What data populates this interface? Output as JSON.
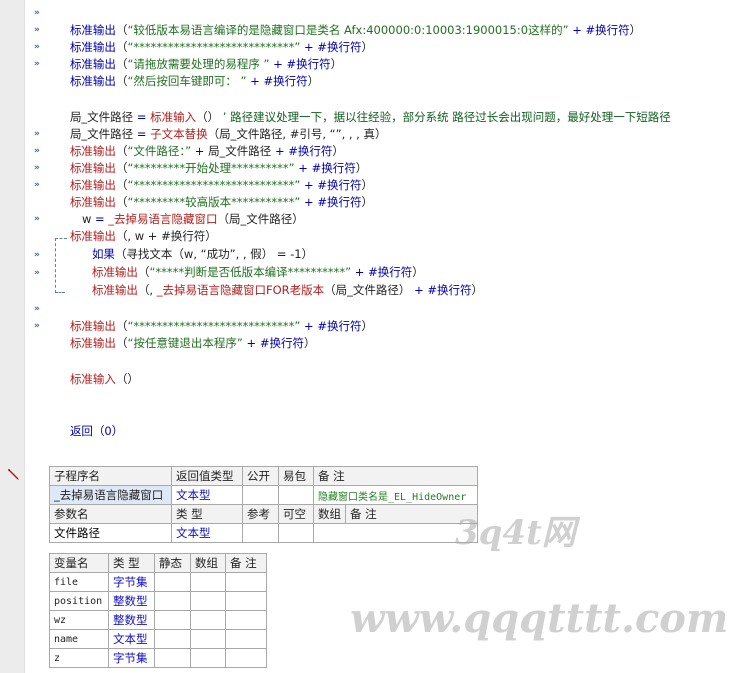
{
  "code": {
    "l1": {
      "fn": "标准输出",
      "a": "（",
      "s": "“较低版本易语言编译的是隐藏窗口是类名 Afx:400000:0:10003:1900015:0这样的”",
      "op": "+",
      "nl": "#换行符",
      "b": "）"
    },
    "l2": {
      "fn": "标准输出",
      "a": "（",
      "s": "“****************************”",
      "op": "+",
      "nl": "#换行符",
      "b": "）"
    },
    "l3": {
      "fn": "标准输出",
      "a": "（",
      "s": "“请拖放需要处理的易程序 ”",
      "op": "+",
      "nl": "#换行符",
      "b": "）"
    },
    "l4": {
      "fn": "标准输出",
      "a": "（",
      "s": "“然后按回车键即可： ”",
      "op": "+",
      "nl": "#换行符",
      "b": "）"
    },
    "l5": {
      "var": "局_文件路径",
      "eq": "=",
      "fn": "标准输入",
      "args": "（）",
      "cm": "’ 路径建议处理一下，据以往经验，部分系统 路径过长会出现问题，最好处理一下短路径"
    },
    "l6": {
      "var": "局_文件路径",
      "eq": "=",
      "fn": "子文本替换",
      "args": "（局_文件路径, #引号, “”, , , 真）"
    },
    "l7": {
      "fn": "标准输出",
      "a": "（",
      "s": "“文件路径：”",
      "op": "+",
      "v": "局_文件路径",
      "op2": "+",
      "nl": "#换行符",
      "b": "）"
    },
    "l8": {
      "fn": "标准输出",
      "a": "（",
      "s": "“*********开始处理**********”",
      "op": "+",
      "nl": "#换行符",
      "b": "）"
    },
    "l9": {
      "fn": "标准输出",
      "a": "（",
      "s": "“****************************”",
      "op": "+",
      "nl": "#换行符",
      "b": "）"
    },
    "l10": {
      "fn": "标准输出",
      "a": "（",
      "s": "“*********较高版本***********”",
      "op": "+",
      "nl": "#换行符",
      "b": "）"
    },
    "l11": {
      "var": "w",
      "eq": "=",
      "fn": "_去掉易语言隐藏窗口",
      "args": "（局_文件路径）"
    },
    "l12": {
      "fn": "标准输出",
      "args": "（, w + #换行符）"
    },
    "l13": {
      "fn": "如果",
      "args": "（寻找文本（w, “成功”, , 假）",
      "rest": "= -1）"
    },
    "l14": {
      "fn": "标准输出",
      "a": "（",
      "s": "“*****判断是否低版本编译**********”",
      "op": "+",
      "nl": "#换行符",
      "b": "）"
    },
    "l15": {
      "fn": "标准输出",
      "a": "（,",
      "f2": "_去掉易语言隐藏窗口FOR老版本",
      "args2": "（局_文件路径）",
      "op": "+",
      "nl": "#换行符",
      "b": "）"
    },
    "l16": {
      "fn": "标准输出",
      "a": "（",
      "s": "“****************************”",
      "op": "+",
      "nl": "#换行符",
      "b": "）"
    },
    "l17": {
      "fn": "标准输出",
      "a": "（",
      "s": "“按任意键退出本程序”",
      "op": "+",
      "nl": "#换行符",
      "b": "）"
    },
    "l18": {
      "fn": "标准输入",
      "args": "（）"
    },
    "l19": {
      "fn": "返回",
      "args": "（0）"
    }
  },
  "sub_table": {
    "headers": [
      "子程序名",
      "返回值类型",
      "公开",
      "易包",
      "备 注"
    ],
    "row": {
      "name": "_去掉易语言隐藏窗口",
      "ret": "文本型",
      "pub": "",
      "pkg": "",
      "note": "隐藏窗口类名是_EL_HideOwner"
    },
    "param_headers": [
      "参数名",
      "类 型",
      "参考",
      "可空",
      "数组",
      "备 注"
    ],
    "param": {
      "name": "文件路径",
      "type": "文本型"
    }
  },
  "var_table": {
    "headers": [
      "变量名",
      "类 型",
      "静态",
      "数组",
      "备 注"
    ],
    "rows": [
      {
        "name": "file",
        "type": "字节集"
      },
      {
        "name": "position",
        "type": "整数型"
      },
      {
        "name": "wz",
        "type": "整数型"
      },
      {
        "name": "name",
        "type": "文本型"
      },
      {
        "name": "z",
        "type": "字节集"
      }
    ]
  },
  "watermark": {
    "a": "3q4t网",
    "b": "www.qqqtttt.com"
  },
  "marker": "»"
}
